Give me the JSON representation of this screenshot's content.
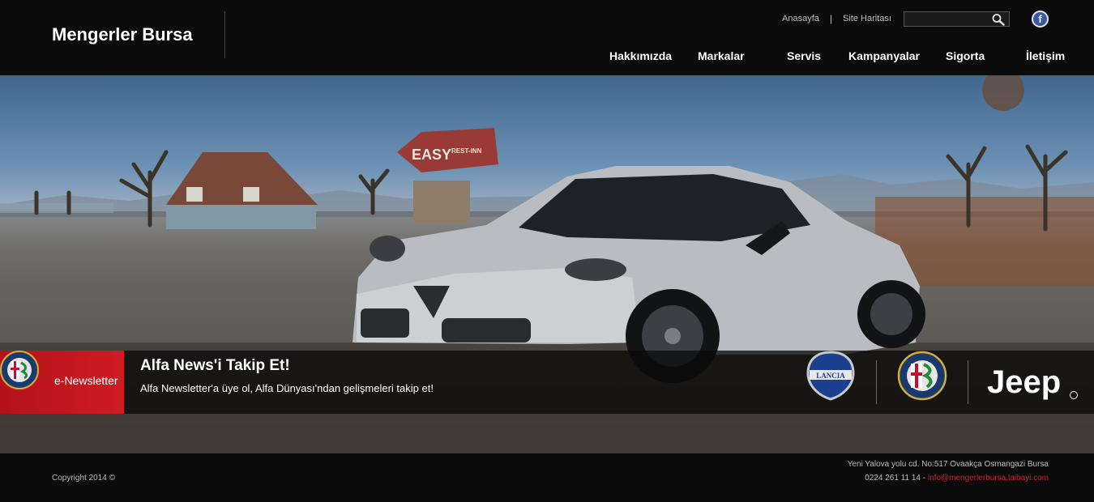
{
  "header": {
    "brand": "Mengerler Bursa",
    "toplinks": {
      "home": "Anasayfa",
      "separator": "|",
      "sitemap": "Site Haritası"
    },
    "search": {
      "value": "",
      "placeholder": ""
    },
    "facebook_glyph": "f",
    "nav": [
      "Hakkımızda",
      "Markalar",
      "Servis",
      "Kampanyalar",
      "Sigorta",
      "İletişim"
    ]
  },
  "hero": {
    "sign_text": "EASY",
    "sign_small": "REST-INN"
  },
  "newsletter": {
    "label": "e-Newsletter",
    "title": "Alfa News'i Takip Et!",
    "subtitle": "Alfa Newsletter'a üye ol, Alfa Dünyası'ndan gelişmeleri takip et!",
    "logos": {
      "lancia": "LANCIA",
      "alfa": "ALFA ROMEO",
      "jeep": "Jeep"
    }
  },
  "footer": {
    "copyright": "Copyright 2014 ©",
    "address": "Yeni Yalova yolu cd. No:517 Ovaakça   Osmangazi Bursa",
    "phone": "0224 261 11 14 -",
    "email": "info@mengerlerbursa.laibayi.com"
  },
  "colors": {
    "accent": "#d01b22",
    "header_bg": "#0b0b0b",
    "email": "#c0272d",
    "facebook": "#3b5998"
  }
}
